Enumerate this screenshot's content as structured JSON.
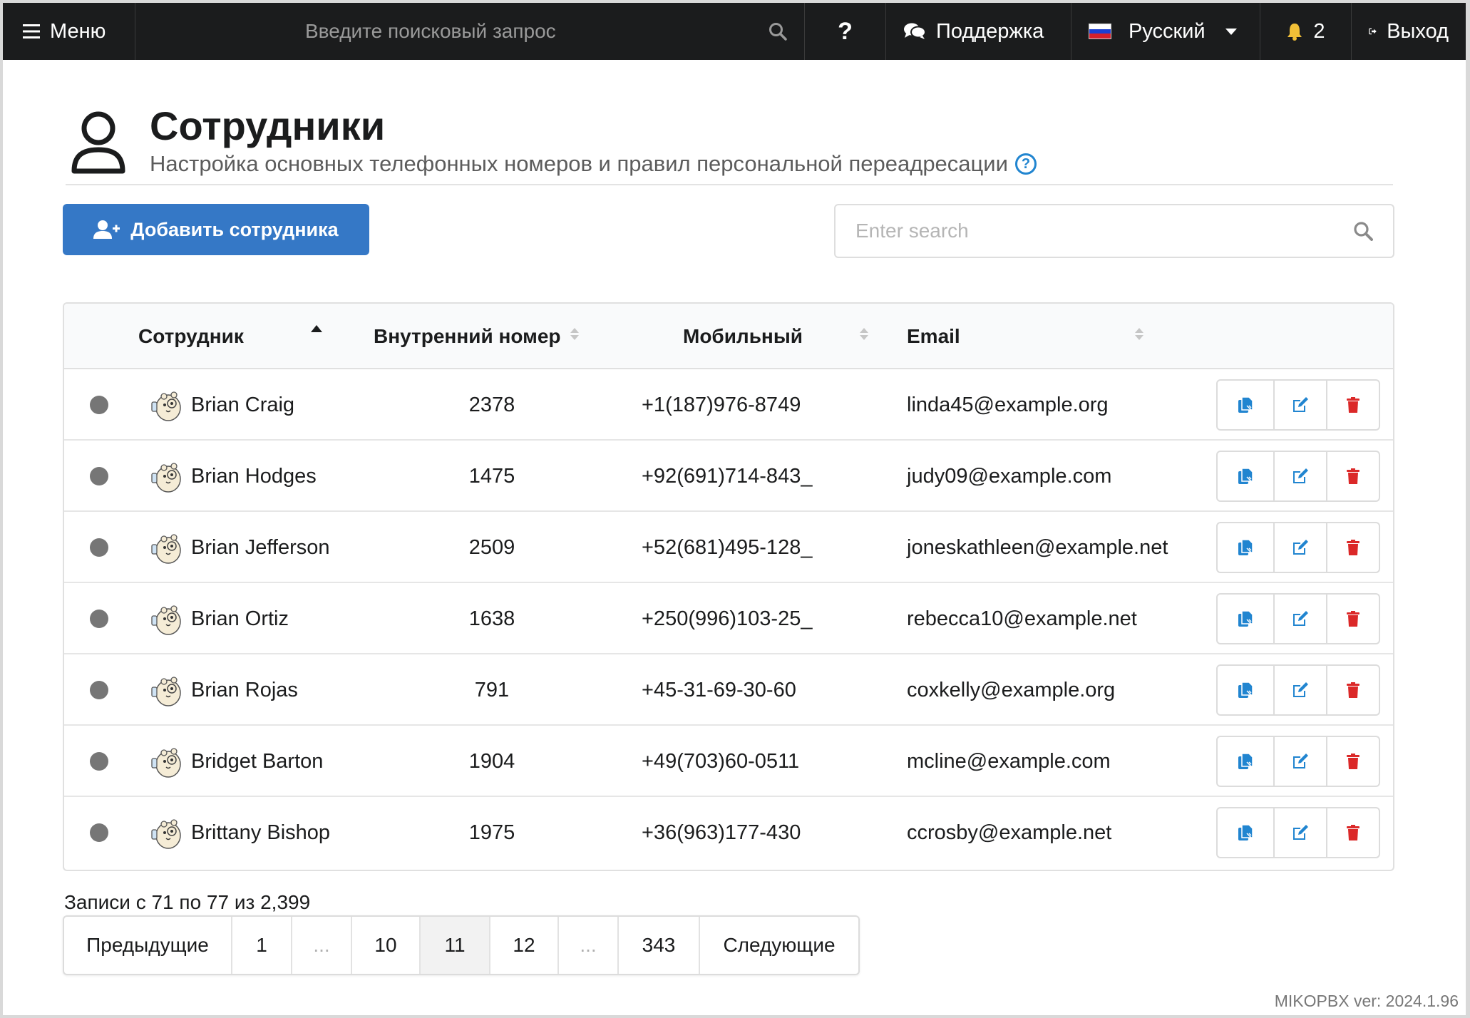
{
  "topbar": {
    "menu_label": "Меню",
    "search_placeholder": "Введите поисковый запрос",
    "help_label": "?",
    "support_label": "Поддержка",
    "language_label": "Русский",
    "notification_count": "2",
    "logout_label": "Выход"
  },
  "header": {
    "title": "Сотрудники",
    "subtitle": "Настройка основных телефонных номеров и правил персональной переадресации"
  },
  "toolbar": {
    "add_label": "Добавить сотрудника",
    "search_placeholder": "Enter search"
  },
  "table": {
    "columns": {
      "employee": "Сотрудник",
      "extension": "Внутренний номер",
      "mobile": "Мобильный",
      "email": "Email"
    },
    "rows": [
      {
        "name": "Brian Craig",
        "extension": "2378",
        "mobile": "+1(187)976-8749",
        "email": "linda45@example.org"
      },
      {
        "name": "Brian Hodges",
        "extension": "1475",
        "mobile": "+92(691)714-843_",
        "email": "judy09@example.com"
      },
      {
        "name": "Brian Jefferson",
        "extension": "2509",
        "mobile": "+52(681)495-128_",
        "email": "joneskathleen@example.net"
      },
      {
        "name": "Brian Ortiz",
        "extension": "1638",
        "mobile": "+250(996)103-25_",
        "email": "rebecca10@example.net"
      },
      {
        "name": "Brian Rojas",
        "extension": "791",
        "mobile": "+45-31-69-30-60",
        "email": "coxkelly@example.org"
      },
      {
        "name": "Bridget Barton",
        "extension": "1904",
        "mobile": "+49(703)60-0511",
        "email": "mcline@example.com"
      },
      {
        "name": "Brittany Bishop",
        "extension": "1975",
        "mobile": "+36(963)177-430",
        "email": "ccrosby@example.net"
      }
    ]
  },
  "footer": {
    "info": "Записи с 71 по 77 из 2,399",
    "pagination": {
      "prev": "Предыдущие",
      "p1": "1",
      "ellipsis1": "...",
      "p10": "10",
      "p11": "11",
      "p12": "12",
      "ellipsis2": "...",
      "p343": "343",
      "next": "Следующие"
    },
    "version": "MIKOPBX ver: 2024.1.96"
  },
  "colors": {
    "topbar": "#1b1c1d",
    "primary": "#3578c6",
    "delete": "#db2828",
    "status_offline": "#767676"
  }
}
